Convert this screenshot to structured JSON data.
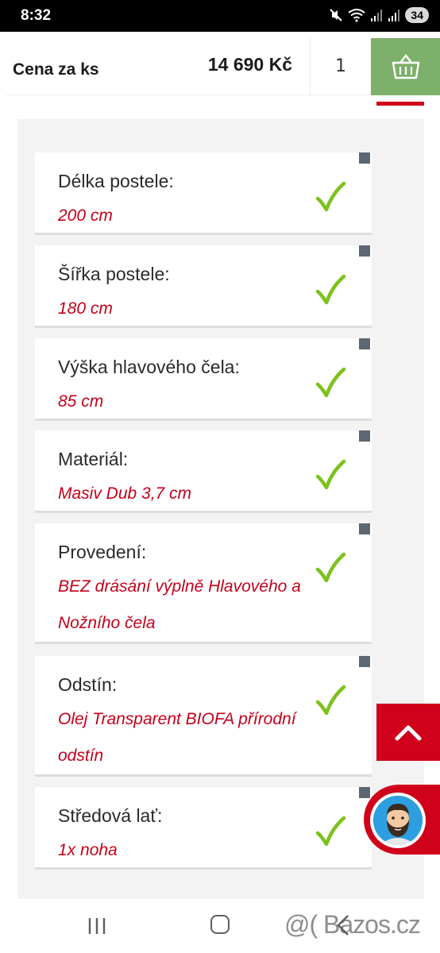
{
  "status": {
    "time": "8:32",
    "battery": "34",
    "icons": [
      "mute-icon",
      "wifi-icon",
      "signal-icon",
      "signal-icon"
    ]
  },
  "product_bar": {
    "price_label": "Cena za ks",
    "price": "14 690 Kč",
    "quantity": "1",
    "cart_icon": "basket-icon",
    "accent": "#7db06a"
  },
  "options": [
    {
      "title": "Délka postele:",
      "value_lines": [
        "200 cm"
      ]
    },
    {
      "title": "Šířka postele:",
      "value_lines": [
        "180 cm"
      ]
    },
    {
      "title": "Výška hlavového čela:",
      "value_lines": [
        "85 cm"
      ]
    },
    {
      "title": "Materiál:",
      "value_lines": [
        "Masiv Dub 3,7 cm"
      ]
    },
    {
      "title": "Provedení:",
      "value_lines": [
        "BEZ drásání výplně Hlavového a",
        "Nožního čela"
      ]
    },
    {
      "title": "Odstín:",
      "value_lines": [
        "Olej Transparent BIOFA přírodní",
        "odstín"
      ]
    },
    {
      "title": "Středová lať:",
      "value_lines": [
        "1x noha"
      ]
    }
  ],
  "colors": {
    "value_text": "#c4001a",
    "check": "#7cc21c",
    "scroll_button": "#d0021b"
  },
  "watermark": "@( Bazos.cz"
}
